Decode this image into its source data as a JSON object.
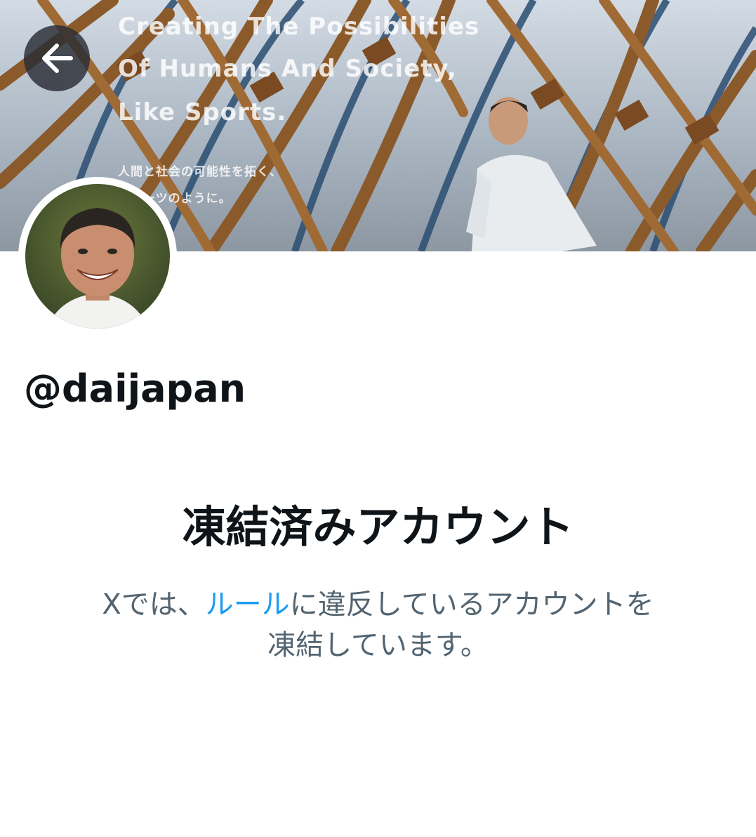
{
  "header": {
    "back_icon": "arrow-left-icon",
    "banner_lines": [
      "Creating The Possibilities",
      "Of Humans And Society,",
      "Like Sports.",
      "人間と社会の可能性を拓く、",
      "スポーツのように。"
    ]
  },
  "profile": {
    "handle": "@daijapan"
  },
  "suspended": {
    "title": "凍結済みアカウント",
    "description_prefix": "Xでは、",
    "rules_link": "ルール",
    "description_suffix_line1": "に違反しているアカウントを",
    "description_line2": "凍結しています。"
  },
  "colors": {
    "link": "#1d9bf0",
    "text_primary": "#0f1419",
    "text_secondary": "#536471"
  }
}
